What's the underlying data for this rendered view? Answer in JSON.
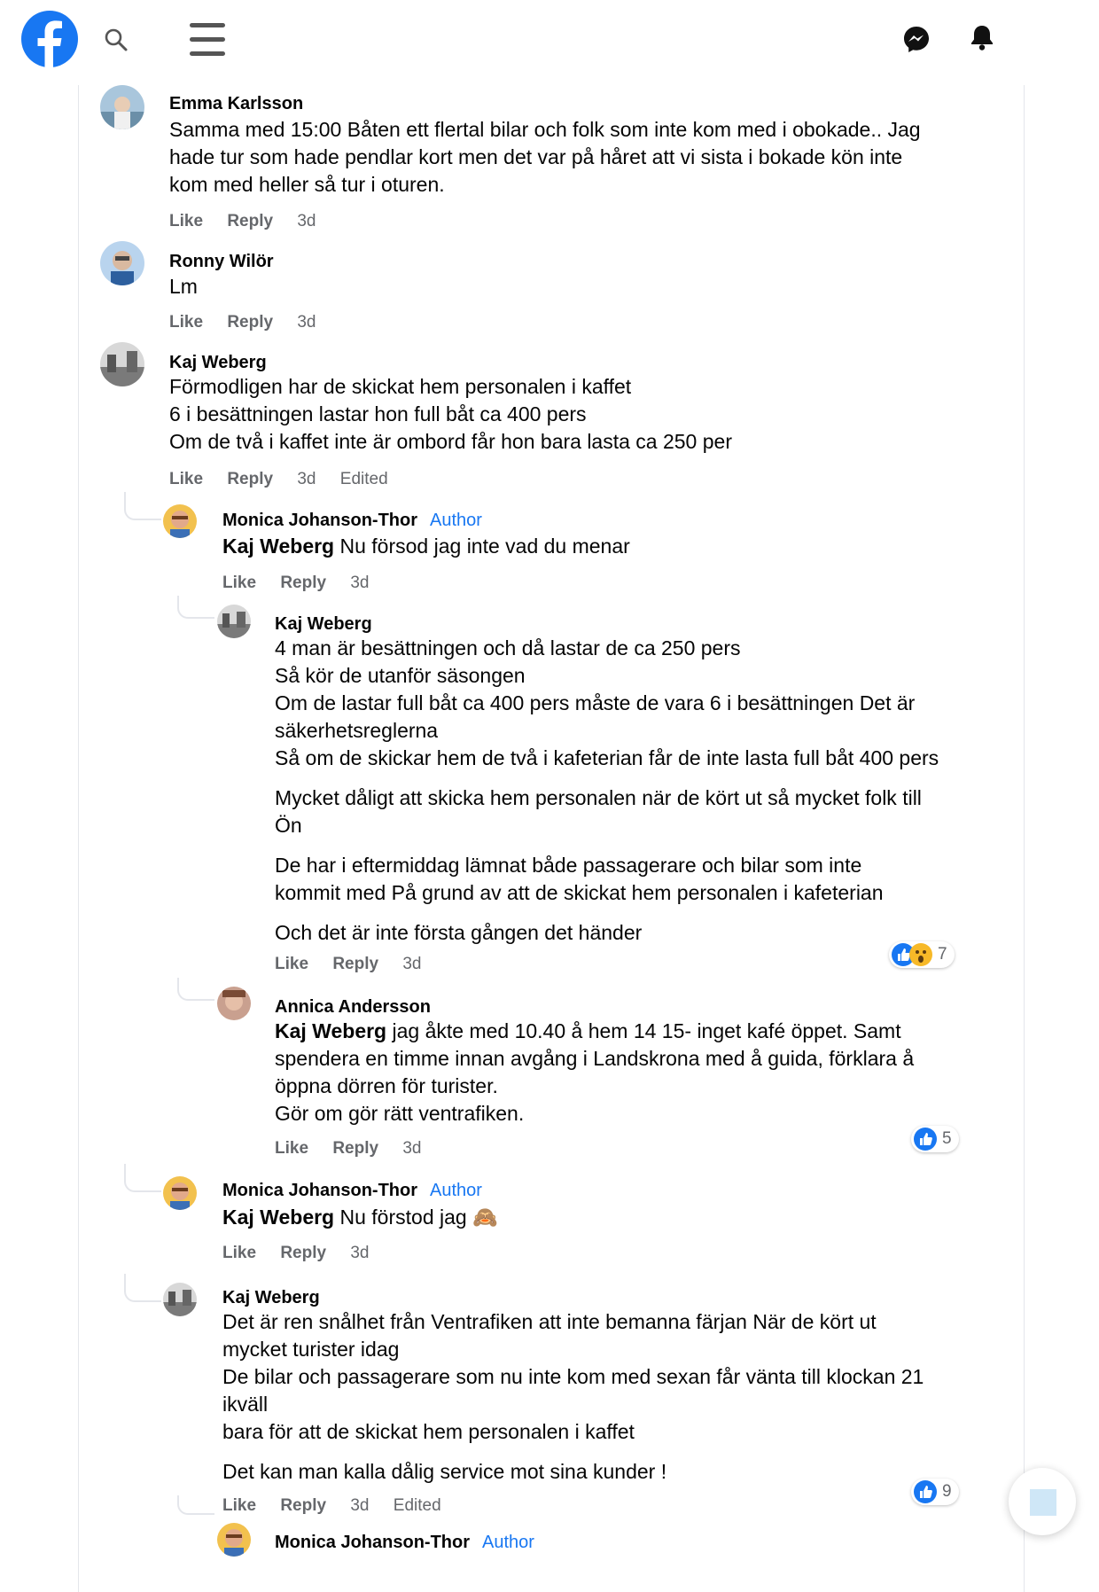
{
  "topbar": {
    "logo_icon": "facebook-logo",
    "search_icon": "search-icon",
    "menu_icon": "hamburger-menu-icon",
    "messenger_icon": "messenger-icon",
    "notifications_icon": "bell-icon"
  },
  "colors": {
    "brand": "#1877f2",
    "meta_text": "#65676b",
    "like": "#1877f2",
    "wow": "#f7b928"
  },
  "labels": {
    "like": "Like",
    "reply": "Reply",
    "author": "Author",
    "edited": "Edited"
  },
  "comments": [
    {
      "name": "Emma Karlsson",
      "lines": [
        "Samma med 15:00 Båten ett flertal bilar och folk som inte kom med i obokade.. Jag",
        "hade tur som hade pendlar kort men det var på håret att vi sista i bokade kön inte",
        "kom med heller så tur i oturen."
      ],
      "time": "3d"
    },
    {
      "name": "Ronny Wilör",
      "lines": [
        "Lm"
      ],
      "time": "3d"
    },
    {
      "name": "Kaj Weberg",
      "lines": [
        "Förmodligen har de skickat hem personalen i kaffet",
        "6 i besättningen lastar hon full båt ca 400 pers",
        "Om de två i kaffet inte är ombord får hon bara lasta ca 250 per"
      ],
      "time": "3d",
      "edited": "Edited"
    },
    {
      "name": "Monica Johanson-Thor",
      "badge": "Author",
      "mention": "Kaj Weberg",
      "text": " Nu försod jag inte vad du menar",
      "time": "3d"
    },
    {
      "name": "Kaj Weberg",
      "lines": [
        "4 man är besättningen och då lastar de ca 250 pers",
        "Så kör de utanför säsongen",
        "Om de lastar full båt ca 400 pers måste de vara 6 i besättningen Det är",
        "säkerhetsreglerna",
        "Så om de skickar hem de två i kafeterian får de inte lasta full båt 400 pers",
        "Mycket dåligt att skicka hem personalen när de kört ut så mycket folk till",
        "Ön",
        "De har i eftermiddag lämnat både passagerare och bilar som inte",
        "kommit med På grund av att de skickat hem personalen i kafeterian",
        "Och det är inte första gången det händer"
      ],
      "time": "3d",
      "reactions": "7"
    },
    {
      "name": "Annica Andersson",
      "mention": "Kaj Weberg",
      "first_rest": " jag åkte med 10.40 å hem 14 15- inget kafé öppet. Samt",
      "lines": [
        "spendera en timme innan avgång i Landskrona med å guida, förklara å",
        "öppna dörren för turister.",
        "Gör om gör rätt ventrafiken."
      ],
      "time": "3d",
      "reactions": "5"
    },
    {
      "name": "Monica Johanson-Thor",
      "badge": "Author",
      "mention": "Kaj Weberg",
      "text": " Nu förstod jag 🙈",
      "time": "3d"
    },
    {
      "name": "Kaj Weberg",
      "lines": [
        "Det är ren snålhet från Ventrafiken att inte bemanna färjan När de kört ut",
        "mycket turister idag",
        "De bilar och passagerare som nu inte kom med sexan får vänta till klockan 21",
        "ikväll",
        "bara för att de skickat hem personalen i kaffet",
        "Det kan man kalla dålig service mot sina kunder !"
      ],
      "time": "3d",
      "edited": "Edited",
      "reactions": "9"
    },
    {
      "name": "Monica Johanson-Thor",
      "badge": "Author"
    }
  ]
}
